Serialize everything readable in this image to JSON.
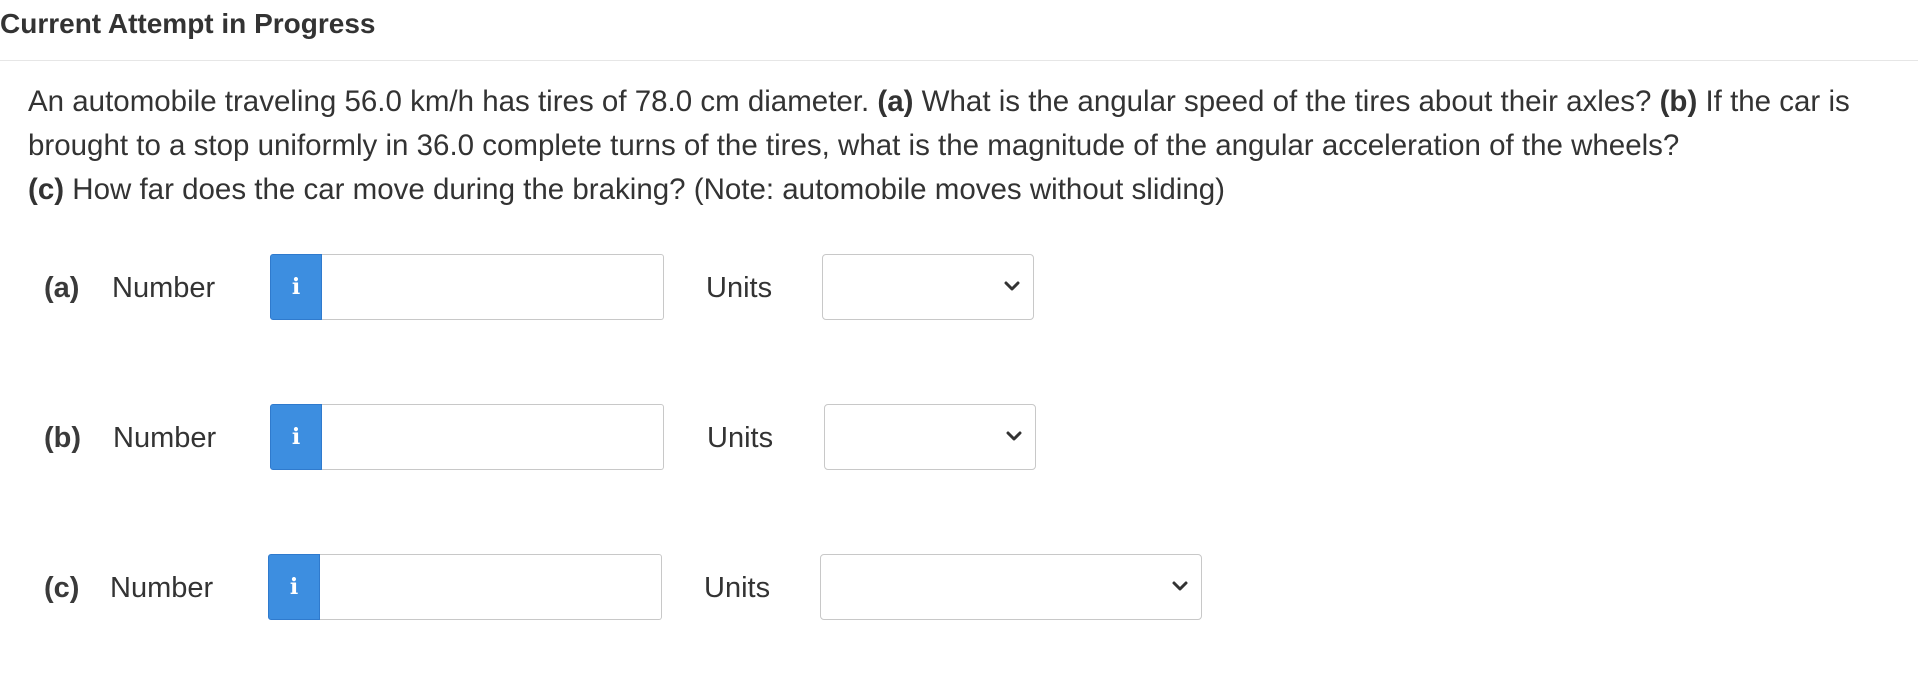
{
  "header": {
    "title": "Current Attempt in Progress"
  },
  "question": {
    "intro": "An automobile traveling 56.0 km/h has tires of 78.0 cm diameter.",
    "part_a_label": "(a)",
    "part_a_text": "What is the angular speed of the tires about their axles?",
    "part_b_label": "(b)",
    "part_b_text": "If the car is brought to a stop uniformly in 36.0 complete turns of the tires, what is the magnitude of the angular acceleration of the wheels?",
    "part_c_label": "(c)",
    "part_c_text": "How far does the car move during the braking? (Note: automobile moves without sliding)"
  },
  "answers": [
    {
      "part": "(a)",
      "number_label": "Number",
      "info_icon": "i",
      "number_value": "",
      "units_label": "Units",
      "units_value": ""
    },
    {
      "part": "(b)",
      "number_label": "Number",
      "info_icon": "i",
      "number_value": "",
      "units_label": "Units",
      "units_value": ""
    },
    {
      "part": "(c)",
      "number_label": "Number",
      "info_icon": "i",
      "number_value": "",
      "units_label": "Units",
      "units_value": ""
    }
  ],
  "colors": {
    "info_button": "#3d8ee0",
    "border": "#c8c8c8",
    "text": "#333333"
  },
  "icons": {
    "info": "info-icon",
    "dropdown": "chevron-down-icon"
  }
}
